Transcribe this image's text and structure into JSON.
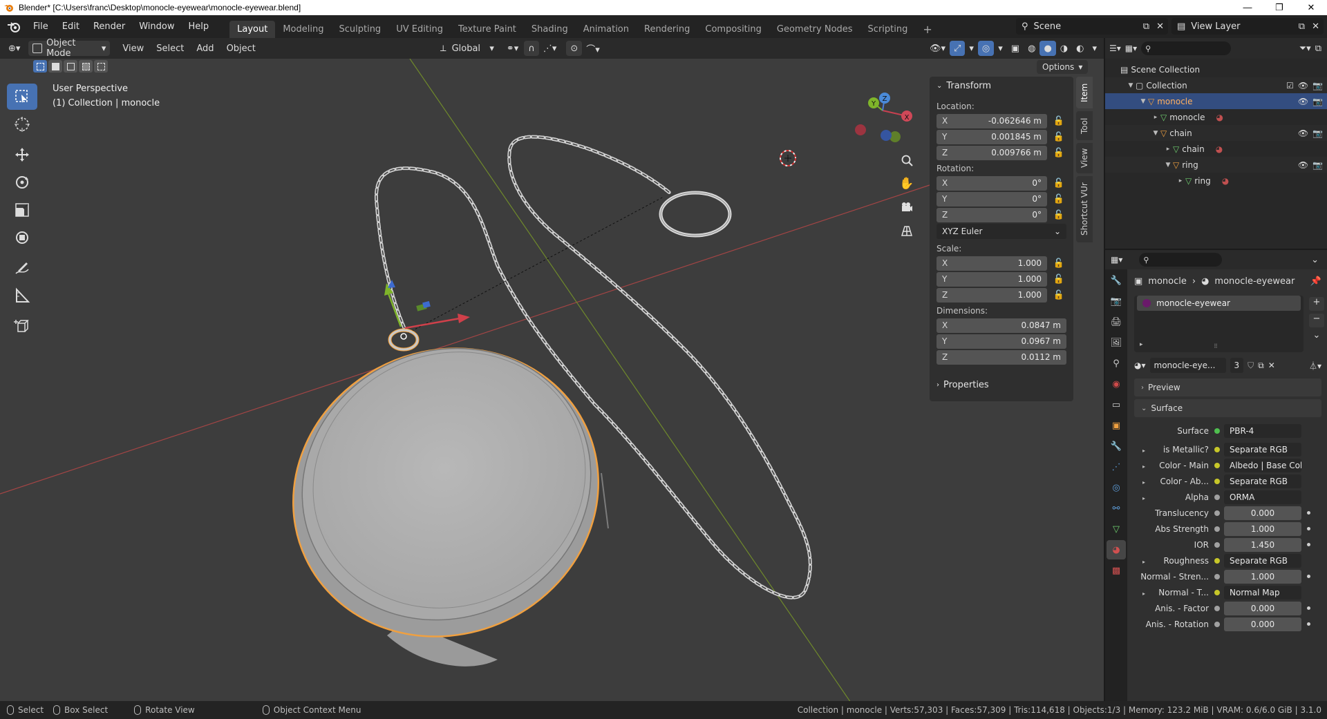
{
  "window": {
    "title": "Blender* [C:\\Users\\franc\\Desktop\\monocle-eyewear\\monocle-eyewear.blend]",
    "buttons": [
      "—",
      "❐",
      "✕"
    ]
  },
  "menubar": {
    "menus": [
      "File",
      "Edit",
      "Render",
      "Window",
      "Help"
    ],
    "workspaces": [
      "Layout",
      "Modeling",
      "Sculpting",
      "UV Editing",
      "Texture Paint",
      "Shading",
      "Animation",
      "Rendering",
      "Compositing",
      "Geometry Nodes",
      "Scripting"
    ],
    "active_workspace": "Layout",
    "add_tab": "+",
    "scene": "Scene",
    "view_layer": "View Layer"
  },
  "viewport_header": {
    "mode": "Object Mode",
    "menus": [
      "View",
      "Select",
      "Add",
      "Object"
    ],
    "orientation": "Global",
    "options": "Options"
  },
  "viewport": {
    "view_name": "User Perspective",
    "collection_info": "(1) Collection | monocle",
    "gizmo_labels": {
      "x": "X",
      "y": "Y",
      "z": "Z"
    }
  },
  "npanel": {
    "tabs": [
      "Item",
      "Tool",
      "View",
      "Shortcut VUr"
    ],
    "transform_title": "Transform",
    "location_label": "Location:",
    "location": [
      {
        "axis": "X",
        "value": "-0.062646 m"
      },
      {
        "axis": "Y",
        "value": "0.001845 m"
      },
      {
        "axis": "Z",
        "value": "0.009766 m"
      }
    ],
    "rotation_label": "Rotation:",
    "rotation": [
      {
        "axis": "X",
        "value": "0°"
      },
      {
        "axis": "Y",
        "value": "0°"
      },
      {
        "axis": "Z",
        "value": "0°"
      }
    ],
    "rotation_mode": "XYZ Euler",
    "scale_label": "Scale:",
    "scale": [
      {
        "axis": "X",
        "value": "1.000"
      },
      {
        "axis": "Y",
        "value": "1.000"
      },
      {
        "axis": "Z",
        "value": "1.000"
      }
    ],
    "dimensions_label": "Dimensions:",
    "dimensions": [
      {
        "axis": "X",
        "value": "0.0847 m"
      },
      {
        "axis": "Y",
        "value": "0.0967 m"
      },
      {
        "axis": "Z",
        "value": "0.0112 m"
      }
    ],
    "properties_title": "Properties"
  },
  "outliner": {
    "rows": [
      {
        "label": "Scene Collection",
        "indent": 0
      },
      {
        "label": "Collection",
        "indent": 1
      },
      {
        "label": "monocle",
        "indent": 2
      },
      {
        "label": "monocle",
        "indent": 3
      },
      {
        "label": "chain",
        "indent": 3
      },
      {
        "label": "chain",
        "indent": 4
      },
      {
        "label": "ring",
        "indent": 4
      },
      {
        "label": "ring",
        "indent": 5
      }
    ]
  },
  "properties": {
    "breadcrumb_object": "monocle",
    "breadcrumb_material": "monocle-eyewear",
    "slot_name": "monocle-eyewear",
    "material_name": "monocle-eye...",
    "user_count": "3",
    "preview_label": "Preview",
    "surface_label": "Surface",
    "rows": [
      {
        "label": "Surface",
        "value": "PBR-4",
        "dot": "#4fbf4f",
        "num": false,
        "tri": false
      },
      {
        "label": "is Metallic?",
        "value": "Separate RGB",
        "dot": "#c7c729",
        "num": false,
        "tri": true
      },
      {
        "label": "Color - Main",
        "value": "Albedo | Base Color",
        "dot": "#c7c729",
        "num": false,
        "tri": true
      },
      {
        "label": "Color - Ab...",
        "value": "Separate RGB",
        "dot": "#c7c729",
        "num": false,
        "tri": true
      },
      {
        "label": "Alpha",
        "value": "ORMA",
        "dot": "#a1a1a1",
        "num": false,
        "tri": true
      },
      {
        "label": "Translucency",
        "value": "0.000",
        "dot": "#a1a1a1",
        "num": true,
        "tri": false
      },
      {
        "label": "Abs Strength",
        "value": "1.000",
        "dot": "#a1a1a1",
        "num": true,
        "tri": false
      },
      {
        "label": "IOR",
        "value": "1.450",
        "dot": "#a1a1a1",
        "num": true,
        "tri": false
      },
      {
        "label": "Roughness",
        "value": "Separate RGB",
        "dot": "#c7c729",
        "num": false,
        "tri": true
      },
      {
        "label": "Normal - Stren...",
        "value": "1.000",
        "dot": "#a1a1a1",
        "num": true,
        "tri": false
      },
      {
        "label": "Normal - T...",
        "value": "Normal Map",
        "dot": "#c7c729",
        "num": false,
        "tri": true
      },
      {
        "label": "Anis. - Factor",
        "value": "0.000",
        "dot": "#a1a1a1",
        "num": true,
        "tri": false
      },
      {
        "label": "Anis. - Rotation",
        "value": "0.000",
        "dot": "#a1a1a1",
        "num": true,
        "tri": false
      }
    ]
  },
  "statusbar": {
    "select": "Select",
    "box_select": "Box Select",
    "rotate_view": "Rotate View",
    "context_menu": "Object Context Menu",
    "stats": "Collection | monocle | Verts:57,303 | Faces:57,309 | Tris:114,618 | Objects:1/3 | Memory: 123.2 MiB | VRAM: 0.6/6.0 GiB | 3.1.0"
  },
  "colors": {
    "accent": "#4772b3",
    "selection": "#334d80",
    "outline_orange": "#f0a040",
    "axis_red": "#d04a4a",
    "axis_green": "#7d9a2a"
  }
}
